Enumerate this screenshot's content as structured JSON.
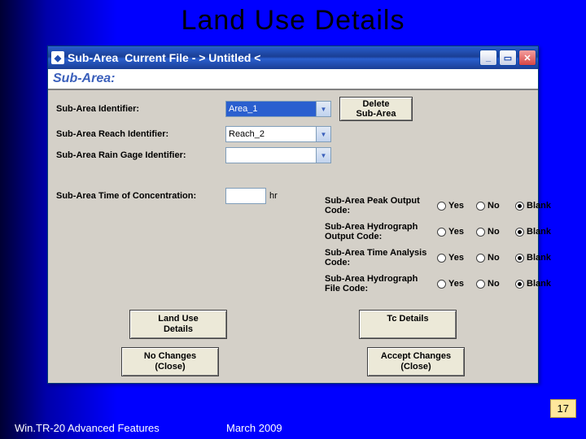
{
  "slide": {
    "title": "Land Use Details",
    "footer_left": "Win.TR-20 Advanced Features",
    "footer_mid": "March 2009",
    "page_number": "17"
  },
  "window": {
    "app_name": "Sub-Area",
    "title_file": "Current File - > Untitled <",
    "header_label": "Sub-Area:"
  },
  "form": {
    "sub_area_id_label": "Sub-Area Identifier:",
    "sub_area_id_value": "Area_1",
    "reach_id_label": "Sub-Area Reach Identifier:",
    "reach_id_value": "Reach_2",
    "rain_gage_label": "Sub-Area Rain Gage Identifier:",
    "rain_gage_value": "",
    "toc_label": "Sub-Area Time of Concentration:",
    "toc_value": "",
    "toc_unit": "hr"
  },
  "buttons": {
    "delete": "Delete\nSub-Area",
    "land_use": "Land Use\nDetails",
    "tc_details": "Tc Details",
    "no_changes": "No Changes\n(Close)",
    "accept_changes": "Accept Changes\n(Close)"
  },
  "radio_rows": [
    {
      "label": "Sub-Area Peak Output Code:",
      "selected": "Blank"
    },
    {
      "label": "Sub-Area Hydrograph Output Code:",
      "selected": "Blank"
    },
    {
      "label": "Sub-Area Time Analysis Code:",
      "selected": "Blank"
    },
    {
      "label": "Sub-Area Hydrograph File Code:",
      "selected": "Blank"
    }
  ],
  "radio_options": {
    "yes": "Yes",
    "no": "No",
    "blank": "Blank"
  }
}
